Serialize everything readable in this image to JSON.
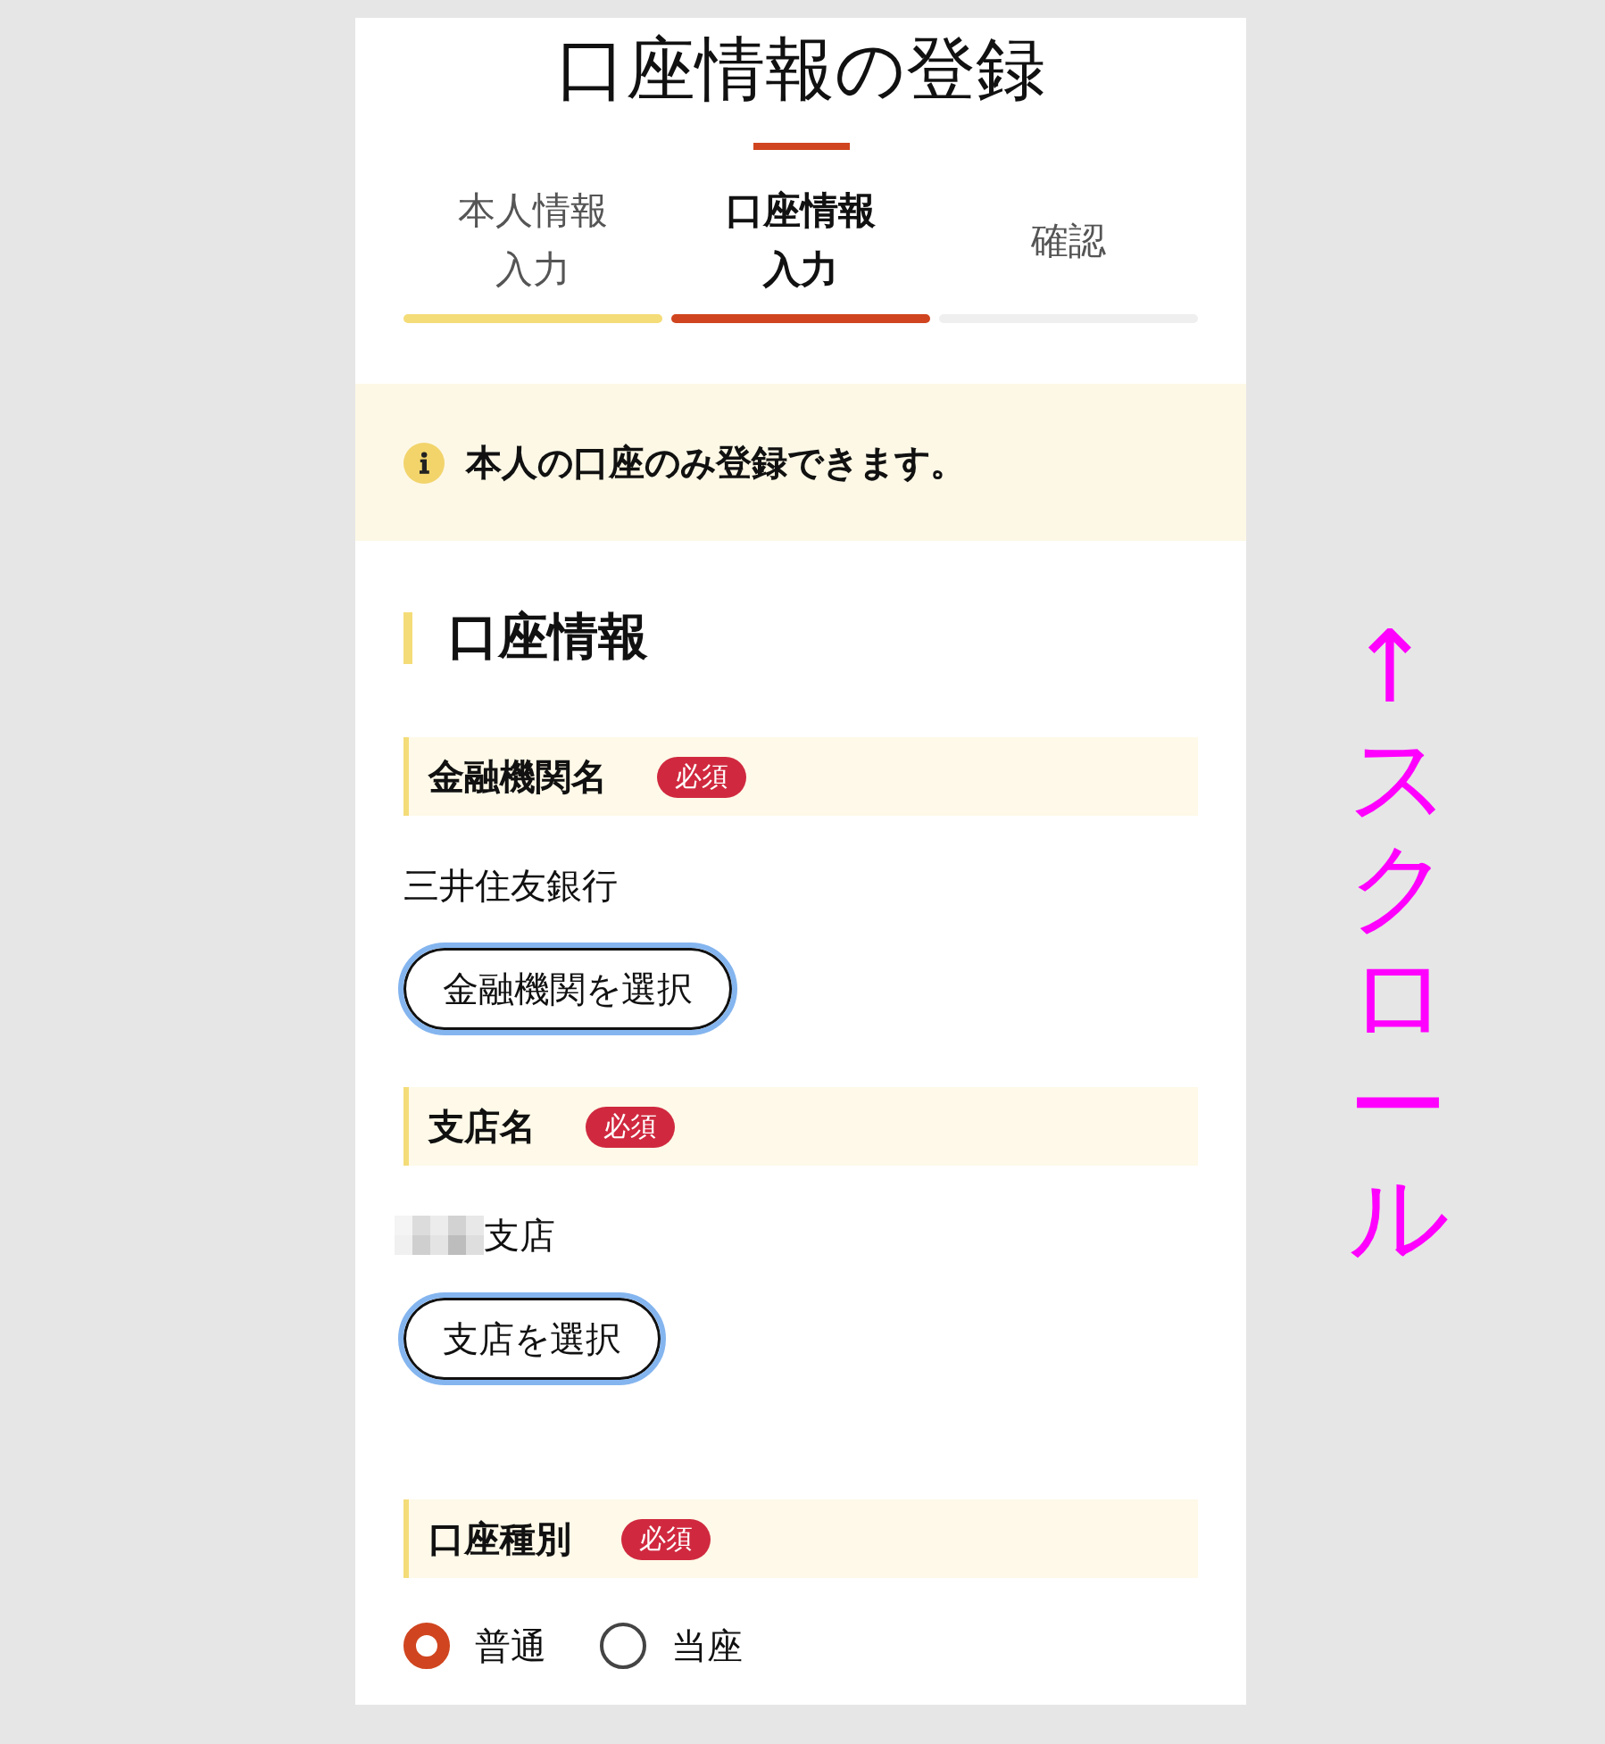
{
  "page": {
    "title": "口座情報の登録"
  },
  "steps": [
    {
      "label": "本人情報入力",
      "completed": true,
      "selected": false
    },
    {
      "label": "口座情報入力",
      "completed": false,
      "selected": true
    },
    {
      "label": "確認",
      "completed": false,
      "selected": false
    }
  ],
  "notice": {
    "text": "本人の口座のみ登録できます。"
  },
  "section": {
    "title": "口座情報",
    "fields": [
      {
        "kind": "select",
        "label": "金融機関名",
        "badge": "必須",
        "value": "三井住友銀行",
        "redacted": false,
        "button": "金融機関を選択"
      },
      {
        "kind": "select",
        "label": "支店名",
        "badge": "必須",
        "value": "支店",
        "redacted": true,
        "button": "支店を選択"
      },
      {
        "kind": "radio",
        "label": "口座種別",
        "badge": "必須",
        "options": [
          {
            "label": "普通",
            "selected": true
          },
          {
            "label": "当座",
            "selected": false
          }
        ]
      }
    ]
  },
  "annotation": {
    "text": "↑スクロール"
  }
}
